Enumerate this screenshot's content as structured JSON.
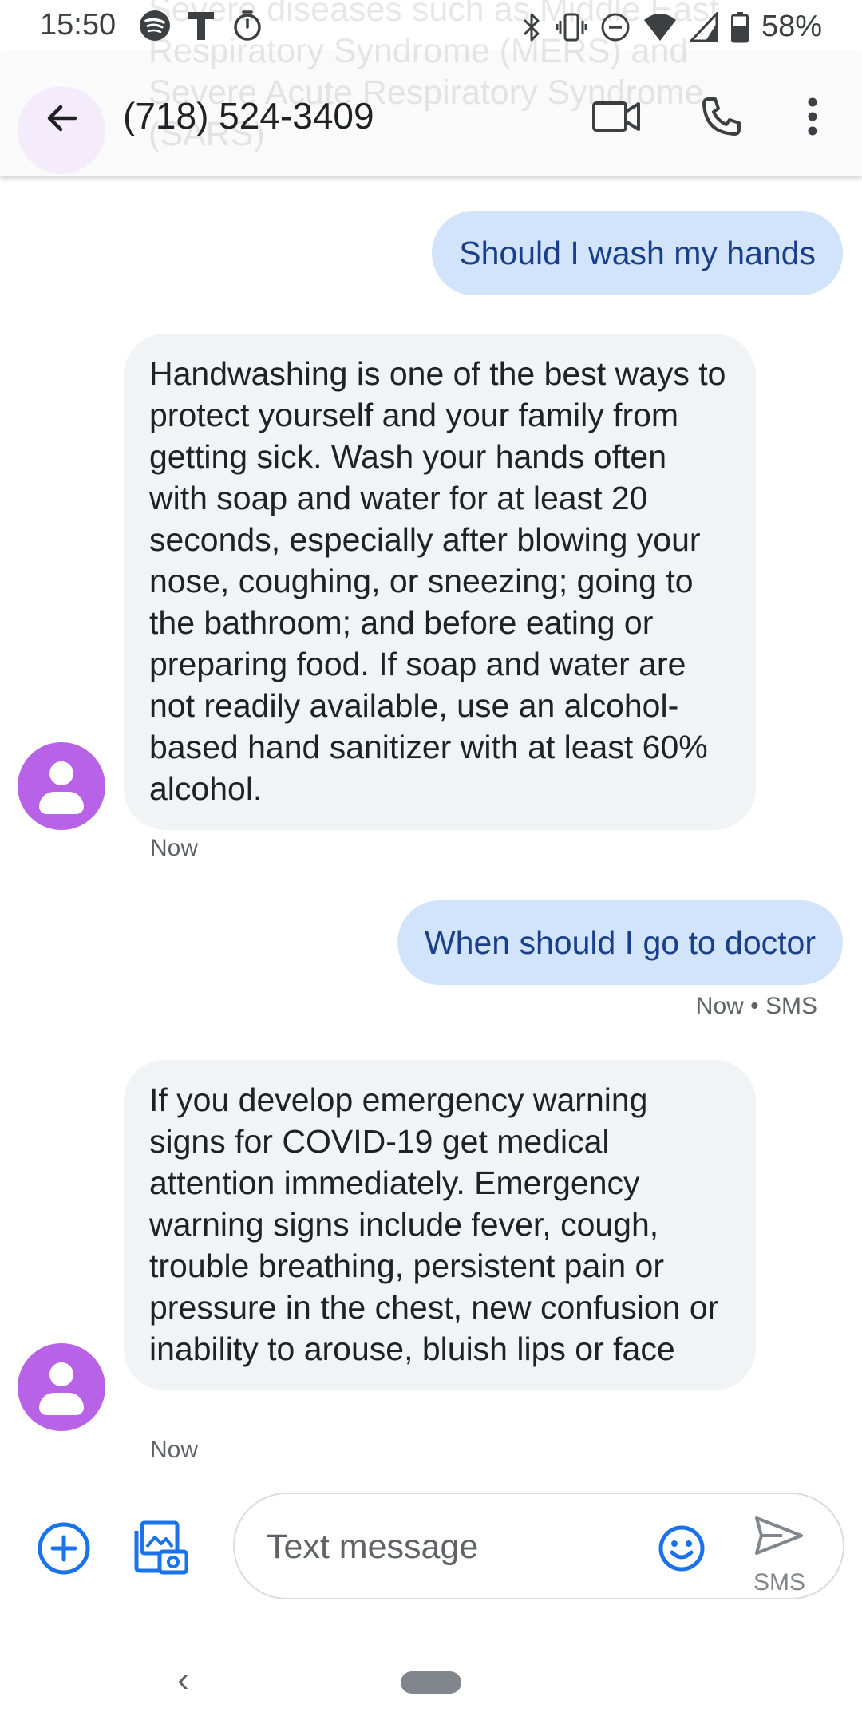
{
  "status_bar": {
    "time": "15:50",
    "battery": "58%",
    "left_icons": [
      "spotify-icon",
      "t-app-icon",
      "timer-icon"
    ],
    "right_icons": [
      "bluetooth-icon",
      "vibrate-icon",
      "do-not-disturb-icon",
      "wifi-icon",
      "signal-icon",
      "battery-icon"
    ]
  },
  "background_notification": {
    "text": "Severe diseases such as Middle East Respiratory Syndrome (MERS) and Severe Acute Respiratory Syndrome (SARS)"
  },
  "app_bar": {
    "title": "(718) 524-3409",
    "actions": [
      "video-call-icon",
      "phone-call-icon",
      "more-options-icon"
    ]
  },
  "messages": [
    {
      "direction": "outgoing",
      "text": "Should I wash my hands"
    },
    {
      "direction": "incoming",
      "text": "Handwashing is one of the best ways to protect yourself and your family from getting sick. Wash your hands often with soap and water for at least 20 seconds, especially after blowing your nose, coughing, or sneezing; going to the bathroom; and before eating or preparing food. If soap and water are not readily available, use an alcohol-based hand sanitizer with at least 60% alcohol.",
      "meta": "Now"
    },
    {
      "direction": "outgoing",
      "text": "When should I go to doctor",
      "meta": "Now • SMS"
    },
    {
      "direction": "incoming",
      "text": "If you develop emergency warning signs for COVID-19 get medical attention immediately. Emergency warning signs include fever, cough, trouble breathing, persistent pain or pressure in the chest, new confusion or inability to arouse, bluish lips or face",
      "meta": "Now"
    }
  ],
  "compose": {
    "placeholder": "Text message",
    "send_label": "SMS"
  },
  "colors": {
    "outgoing_bubble": "#d2e3fc",
    "outgoing_text": "#1a3f8a",
    "incoming_bubble": "#f1f3f4",
    "avatar": "#b862e8",
    "accent": "#1a73e8"
  }
}
